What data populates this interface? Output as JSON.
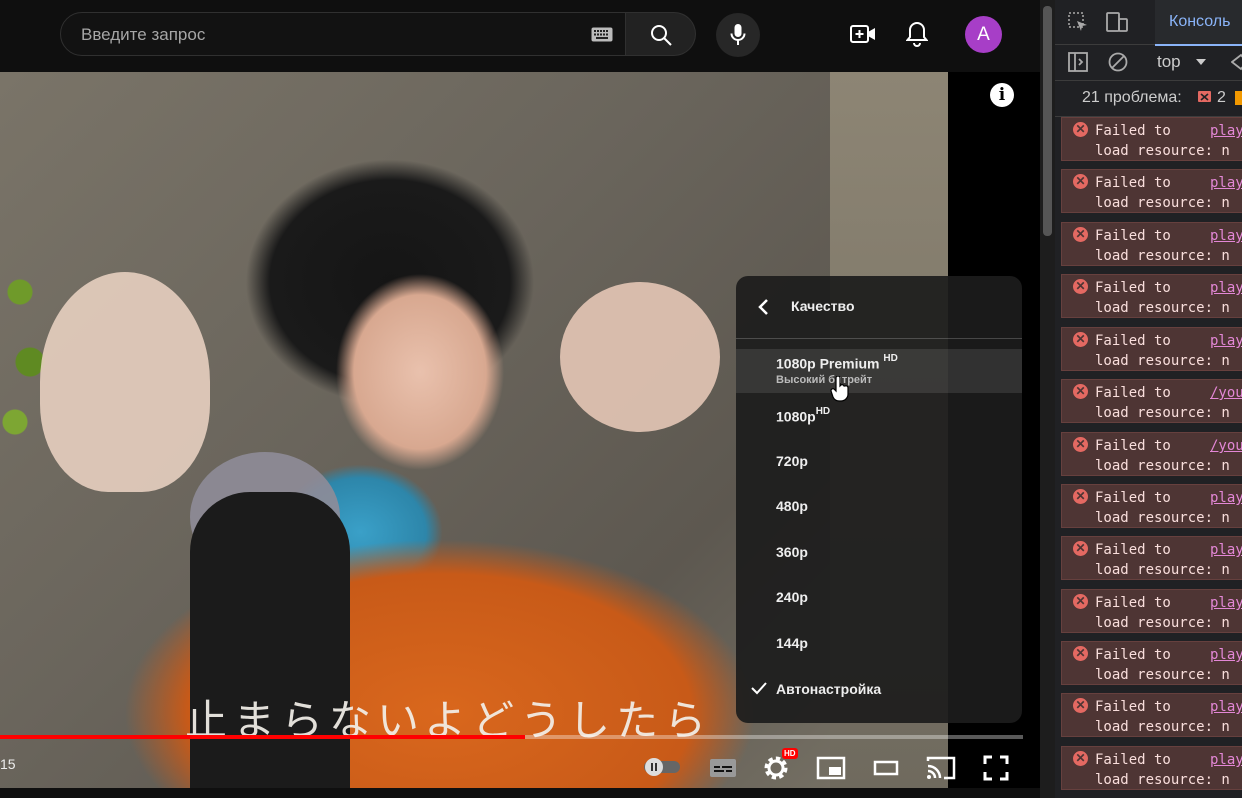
{
  "search": {
    "placeholder": "Введите запрос"
  },
  "header": {
    "avatar_letter": "A"
  },
  "player": {
    "subtitle_text": "止まらないよどうしたら",
    "time": "15",
    "progress": 0.513,
    "quality_badge": "HD"
  },
  "quality_menu": {
    "title": "Качество",
    "items": [
      {
        "label": "1080p Premium",
        "badge": "HD",
        "sub": "Высокий битрейт"
      },
      {
        "label": "1080p",
        "badge": "HD"
      },
      {
        "label": "720p"
      },
      {
        "label": "480p"
      },
      {
        "label": "360p"
      },
      {
        "label": "240p"
      },
      {
        "label": "144p"
      },
      {
        "label": "Автонастройка",
        "selected": true
      }
    ]
  },
  "devtools": {
    "tab_console": "Консоль",
    "context": "top",
    "issues_label": "21 проблема:",
    "issues_error_count": "2",
    "errors": [
      {
        "line1": "Failed to",
        "link": "play",
        "line2": "load resource: n"
      },
      {
        "line1": "Failed to",
        "link": "play",
        "line2": "load resource: n"
      },
      {
        "line1": "Failed to",
        "link": "play",
        "line2": "load resource: n"
      },
      {
        "line1": "Failed to",
        "link": "play",
        "line2": "load resource: n"
      },
      {
        "line1": "Failed to",
        "link": "play",
        "line2": "load resource: n"
      },
      {
        "line1": "Failed to",
        "link": "/you",
        "line2": "load resource: n"
      },
      {
        "line1": "Failed to",
        "link": "/you",
        "line2": "load resource: n"
      },
      {
        "line1": "Failed to",
        "link": "play",
        "line2": "load resource: n"
      },
      {
        "line1": "Failed to",
        "link": "play",
        "line2": "load resource: n"
      },
      {
        "line1": "Failed to",
        "link": "play",
        "line2": "load resource: n"
      },
      {
        "line1": "Failed to",
        "link": "play",
        "line2": "load resource: n"
      },
      {
        "line1": "Failed to",
        "link": "play",
        "line2": "load resource: n"
      },
      {
        "line1": "Failed to",
        "link": "play",
        "line2": "load resource: n"
      }
    ]
  }
}
